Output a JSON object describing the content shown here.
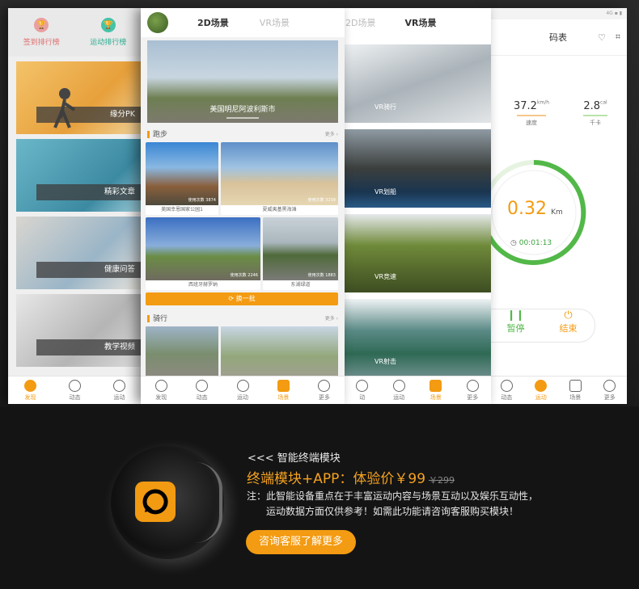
{
  "screen1": {
    "top_left_label": "签到排行榜",
    "top_right_label": "运动排行榜",
    "cards": [
      "缘分PK",
      "精彩文章",
      "健康问答",
      "教学视频"
    ],
    "tabs": [
      "发现",
      "动态",
      "运动"
    ]
  },
  "screen2": {
    "tab_2d": "2D场景",
    "tab_vr": "VR场景",
    "banner_caption": "美国明尼阿波利斯市",
    "section_run": "跑步",
    "section_ride": "骑行",
    "more": "更多 ›",
    "refresh": "⟳ 换一批",
    "thumbs": [
      {
        "caption": "美国幸恩国家公园1",
        "meta": "使用次数 3874"
      },
      {
        "caption": "夏威夷基黑海滩",
        "meta": "使用次数 3239"
      },
      {
        "caption": "西班牙赫罗纳",
        "meta": "使用次数 2246"
      },
      {
        "caption": "东湖绿道",
        "meta": "使用次数 1883"
      }
    ],
    "tabs": [
      "发现",
      "动态",
      "运动",
      "场景",
      "更多"
    ]
  },
  "screen3": {
    "tab_2d": "2D场景",
    "tab_vr": "VR场景",
    "items": [
      "VR骑行",
      "VR划船",
      "VR竞速",
      "VR射击"
    ],
    "tabs": [
      "动",
      "运动",
      "场景",
      "更多"
    ]
  },
  "screen4": {
    "status": "4G ▪ ▮",
    "title": "码表",
    "speed_value": "37.2",
    "speed_unit": "km/h",
    "speed_label": "速度",
    "cal_value": "2.8",
    "cal_unit": "cal",
    "cal_label": "千卡",
    "distance": "0.32",
    "distance_unit": "Km",
    "time": "00:01:13",
    "pause": "暂停",
    "end": "结束",
    "tabs": [
      "动态",
      "运动",
      "场景",
      "更多"
    ]
  },
  "promo": {
    "module_title": "<<<  智能终端模块",
    "price_line": "终端模块+APP：体验价￥99",
    "old_price": "￥299",
    "note_line1": "注：此智能设备重点在于丰富运动内容与场景互动以及娱乐互动性，",
    "note_line2": "运动数据方面仅供参考！如需此功能请咨询客服购买模块！",
    "button": "咨询客服了解更多"
  },
  "colors": {
    "accent": "#f39b12",
    "green": "#55c25a",
    "dark": "#141414"
  }
}
